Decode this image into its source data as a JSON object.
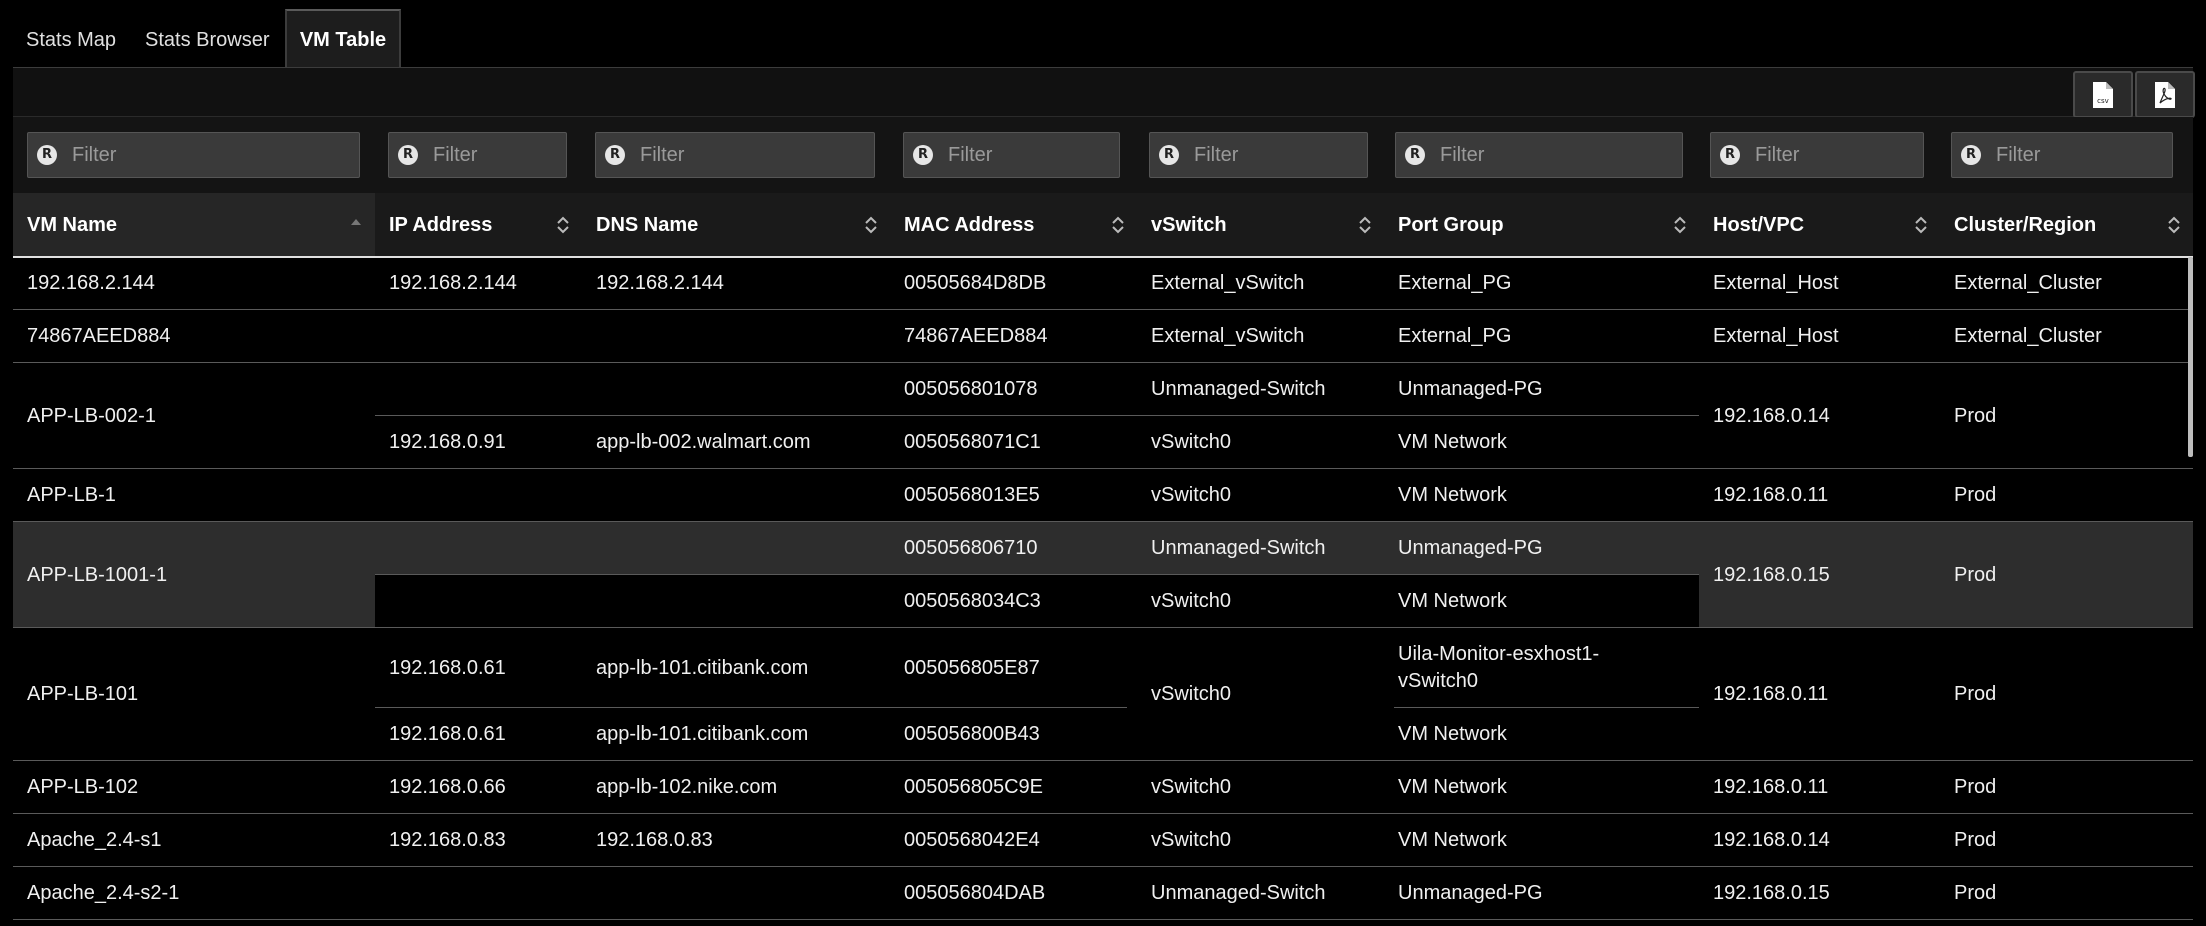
{
  "tabs": [
    {
      "label": "Stats Map"
    },
    {
      "label": "Stats Browser"
    },
    {
      "label": "VM Table",
      "active": true
    }
  ],
  "export_buttons": [
    {
      "icon": "csv-file-icon",
      "label": "csv"
    },
    {
      "icon": "pdf-file-icon"
    }
  ],
  "filter_placeholder": "Filter",
  "filter_icon_label": "R",
  "columns": [
    {
      "label": "VM Name",
      "sort": "ascending"
    },
    {
      "label": "IP Address",
      "sort": "none"
    },
    {
      "label": "DNS Name",
      "sort": "none"
    },
    {
      "label": "MAC Address",
      "sort": "none"
    },
    {
      "label": "vSwitch",
      "sort": "none"
    },
    {
      "label": "Port Group",
      "sort": "none"
    },
    {
      "label": "Host/VPC",
      "sort": "none"
    },
    {
      "label": "Cluster/Region",
      "sort": "none"
    }
  ],
  "rows": [
    {
      "vm": "192.168.2.144",
      "host": "External_Host",
      "cluster": "External_Cluster",
      "sub": [
        {
          "ip": "192.168.2.144",
          "dns": "192.168.2.144",
          "mac": "00505684D8DB",
          "vswitch": "External_vSwitch",
          "pg": "External_PG"
        }
      ]
    },
    {
      "vm": "74867AEED884",
      "host": "External_Host",
      "cluster": "External_Cluster",
      "sub": [
        {
          "ip": "",
          "dns": "",
          "mac": "74867AEED884",
          "vswitch": "External_vSwitch",
          "pg": "External_PG"
        }
      ]
    },
    {
      "vm": "APP-LB-002-1",
      "host": "192.168.0.14",
      "cluster": "Prod",
      "sub": [
        {
          "ip": "",
          "dns": "",
          "mac": "005056801078",
          "vswitch": "Unmanaged-Switch",
          "pg": "Unmanaged-PG"
        },
        {
          "ip": "192.168.0.91",
          "dns": "app-lb-002.walmart.com",
          "mac": "0050568071C1",
          "vswitch": "vSwitch0",
          "pg": "VM Network"
        }
      ]
    },
    {
      "vm": "APP-LB-1",
      "host": "192.168.0.11",
      "cluster": "Prod",
      "sub": [
        {
          "ip": "",
          "dns": "",
          "mac": "0050568013E5",
          "vswitch": "vSwitch0",
          "pg": "VM Network"
        }
      ]
    },
    {
      "vm": "APP-LB-1001-1",
      "host": "192.168.0.15",
      "cluster": "Prod",
      "highlighted": true,
      "sub": [
        {
          "ip": "",
          "dns": "",
          "mac": "005056806710",
          "vswitch": "Unmanaged-Switch",
          "pg": "Unmanaged-PG"
        },
        {
          "ip": "",
          "dns": "",
          "mac": "0050568034C3",
          "vswitch": "vSwitch0",
          "pg": "VM Network"
        }
      ]
    },
    {
      "vm": "APP-LB-101",
      "host": "192.168.0.11",
      "cluster": "Prod",
      "vswitch_merged": "vSwitch0",
      "sub": [
        {
          "ip": "192.168.0.61",
          "dns": "app-lb-101.citibank.com",
          "mac": "005056805E87",
          "pg": "Uila-Monitor-esxhost1-",
          "pg2": "vSwitch0"
        },
        {
          "ip": "192.168.0.61",
          "dns": "app-lb-101.citibank.com",
          "mac": "005056800B43",
          "pg": "VM Network"
        }
      ]
    },
    {
      "vm": "APP-LB-102",
      "host": "192.168.0.11",
      "cluster": "Prod",
      "sub": [
        {
          "ip": "192.168.0.66",
          "dns": "app-lb-102.nike.com",
          "mac": "005056805C9E",
          "vswitch": "vSwitch0",
          "pg": "VM Network"
        }
      ]
    },
    {
      "vm": "Apache_2.4-s1",
      "host": "192.168.0.14",
      "cluster": "Prod",
      "sub": [
        {
          "ip": "192.168.0.83",
          "dns": "192.168.0.83",
          "mac": "0050568042E4",
          "vswitch": "vSwitch0",
          "pg": "VM Network"
        }
      ]
    },
    {
      "vm": "Apache_2.4-s2-1",
      "host": "192.168.0.15",
      "cluster": "Prod",
      "sub": [
        {
          "ip": "",
          "dns": "",
          "mac": "005056804DAB",
          "vswitch": "Unmanaged-Switch",
          "pg": "Unmanaged-PG"
        }
      ]
    }
  ]
}
